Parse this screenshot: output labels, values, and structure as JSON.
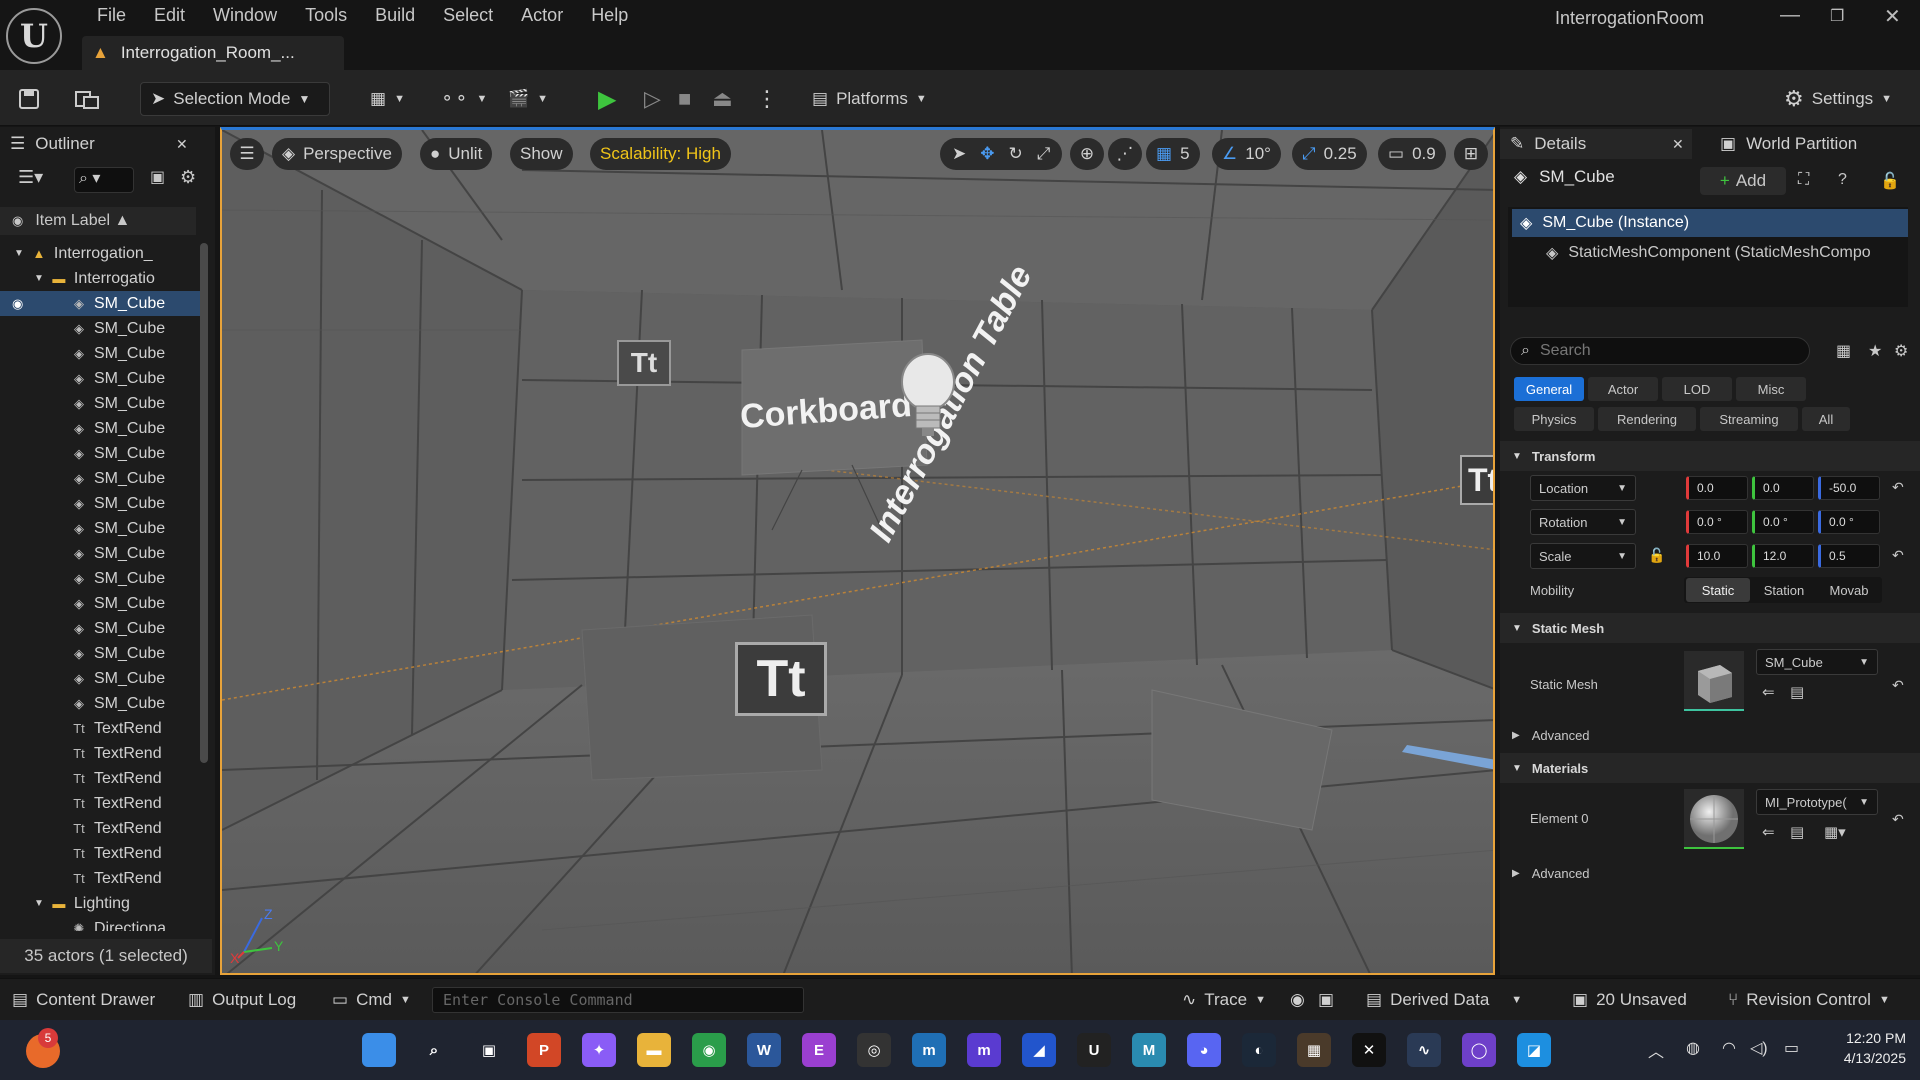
{
  "menubar": {
    "items": [
      "File",
      "Edit",
      "Window",
      "Tools",
      "Build",
      "Select",
      "Actor",
      "Help"
    ]
  },
  "document_tab": "Interrogation_Room_...",
  "window_title": "InterrogationRoom",
  "toolbar": {
    "selection_mode": "Selection Mode",
    "platforms": "Platforms",
    "settings": "Settings"
  },
  "outliner": {
    "tab": "Outliner",
    "column": "Item Label ▲",
    "tree": [
      {
        "label": "Interrogation_",
        "icon": "level-icon",
        "indent": 1
      },
      {
        "label": "Interrogatio",
        "icon": "folder-icon",
        "indent": 2
      },
      {
        "label": "SM_Cube",
        "icon": "mesh-icon",
        "indent": 3,
        "selected": true
      },
      {
        "label": "SM_Cube",
        "icon": "mesh-icon",
        "indent": 3
      },
      {
        "label": "SM_Cube",
        "icon": "mesh-icon",
        "indent": 3
      },
      {
        "label": "SM_Cube",
        "icon": "mesh-icon",
        "indent": 3
      },
      {
        "label": "SM_Cube",
        "icon": "mesh-icon",
        "indent": 3
      },
      {
        "label": "SM_Cube",
        "icon": "mesh-icon",
        "indent": 3
      },
      {
        "label": "SM_Cube",
        "icon": "mesh-icon",
        "indent": 3
      },
      {
        "label": "SM_Cube",
        "icon": "mesh-icon",
        "indent": 3
      },
      {
        "label": "SM_Cube",
        "icon": "mesh-icon",
        "indent": 3
      },
      {
        "label": "SM_Cube",
        "icon": "mesh-icon",
        "indent": 3
      },
      {
        "label": "SM_Cube",
        "icon": "mesh-icon",
        "indent": 3
      },
      {
        "label": "SM_Cube",
        "icon": "mesh-icon",
        "indent": 3
      },
      {
        "label": "SM_Cube",
        "icon": "mesh-icon",
        "indent": 3
      },
      {
        "label": "SM_Cube",
        "icon": "mesh-icon",
        "indent": 3
      },
      {
        "label": "SM_Cube",
        "icon": "mesh-icon",
        "indent": 3
      },
      {
        "label": "SM_Cube",
        "icon": "mesh-icon",
        "indent": 3
      },
      {
        "label": "SM_Cube",
        "icon": "mesh-icon",
        "indent": 3
      },
      {
        "label": "TextRend",
        "icon": "text-render-icon",
        "indent": 3
      },
      {
        "label": "TextRend",
        "icon": "text-render-icon",
        "indent": 3
      },
      {
        "label": "TextRend",
        "icon": "text-render-icon",
        "indent": 3
      },
      {
        "label": "TextRend",
        "icon": "text-render-icon",
        "indent": 3
      },
      {
        "label": "TextRend",
        "icon": "text-render-icon",
        "indent": 3
      },
      {
        "label": "TextRend",
        "icon": "text-render-icon",
        "indent": 3
      },
      {
        "label": "TextRend",
        "icon": "text-render-icon",
        "indent": 3
      },
      {
        "label": "Lighting",
        "icon": "folder-icon",
        "indent": 2
      },
      {
        "label": "Directiona",
        "icon": "light-icon",
        "indent": 3
      }
    ],
    "footer": "35 actors (1 selected)"
  },
  "viewport": {
    "perspective": "Perspective",
    "unlit": "Unlit",
    "show": "Show",
    "scalability": "Scalability: High",
    "grid_snap": "5",
    "angle_snap": "10°",
    "scale_snap": "0.25",
    "camera_speed": "0.9",
    "corkboard_text": "Corkboard",
    "interrogation_text": "Interrogation Table",
    "axis": {
      "z": "Z",
      "y": "Y",
      "x": "X"
    }
  },
  "details": {
    "tab": "Details",
    "tab2": "World Partition",
    "actor_name": "SM_Cube",
    "add": "Add",
    "components": [
      "SM_Cube (Instance)",
      "StaticMeshComponent (StaticMeshCompo"
    ],
    "search_placeholder": "Search",
    "filters_row1": [
      "General",
      "Actor",
      "LOD",
      "Misc"
    ],
    "filters_row2": [
      "Physics",
      "Rendering",
      "Streaming",
      "All"
    ],
    "transform": {
      "title": "Transform",
      "location": {
        "label": "Location",
        "x": "0.0",
        "y": "0.0",
        "z": "-50.0"
      },
      "rotation": {
        "label": "Rotation",
        "x": "0.0 °",
        "y": "0.0 °",
        "z": "0.0 °"
      },
      "scale": {
        "label": "Scale",
        "x": "10.0",
        "y": "12.0",
        "z": "0.5"
      },
      "mobility": {
        "label": "Mobility",
        "options": [
          "Static",
          "Station",
          "Movab"
        ]
      }
    },
    "static_mesh": {
      "title": "Static Mesh",
      "label": "Static Mesh",
      "value": "SM_Cube"
    },
    "advanced": "Advanced",
    "materials": {
      "title": "Materials",
      "label": "Element 0",
      "value": "MI_Prototype("
    }
  },
  "statusbar": {
    "content_drawer": "Content Drawer",
    "output_log": "Output Log",
    "cmd": "Cmd",
    "console_placeholder": "Enter Console Command",
    "trace": "Trace",
    "derived_data": "Derived Data",
    "unsaved": "20 Unsaved",
    "revision_control": "Revision Control"
  },
  "taskbar": {
    "badge": "5",
    "time": "12:20 PM",
    "date": "4/13/2025",
    "apps": [
      {
        "name": "windows-start-icon",
        "color": "#3b8ee8",
        "label": ""
      },
      {
        "name": "search-icon",
        "color": "#1f2430",
        "label": "⌕"
      },
      {
        "name": "task-view-icon",
        "color": "#1f2430",
        "label": "▣"
      },
      {
        "name": "powerpoint-icon",
        "color": "#d24726",
        "label": "P"
      },
      {
        "name": "copilot-icon",
        "color": "#8a5cf6",
        "label": "✦"
      },
      {
        "name": "file-explorer-icon",
        "color": "#e8b33a",
        "label": "▬"
      },
      {
        "name": "chrome-icon",
        "color": "#2a9d4a",
        "label": "◉"
      },
      {
        "name": "word-icon",
        "color": "#2b579a",
        "label": "W"
      },
      {
        "name": "editor-icon",
        "color": "#9a3fd0",
        "label": "E"
      },
      {
        "name": "obs-icon",
        "color": "#333",
        "label": "◎"
      },
      {
        "name": "vscode-insiders-icon",
        "color": "#1f6fb5",
        "label": "m"
      },
      {
        "name": "mu-icon",
        "color": "#5a3bd0",
        "label": "m"
      },
      {
        "name": "app-icon",
        "color": "#2255cc",
        "label": "◢"
      },
      {
        "name": "unreal-icon",
        "color": "#222",
        "label": "U"
      },
      {
        "name": "maya-icon",
        "color": "#2a8bb0",
        "label": "M"
      },
      {
        "name": "discord-icon",
        "color": "#5865f2",
        "label": "◕"
      },
      {
        "name": "steam-icon",
        "color": "#1b2838",
        "label": "◐"
      },
      {
        "name": "minecraft-icon",
        "color": "#4a3a2a",
        "label": "▦"
      },
      {
        "name": "capcut-icon",
        "color": "#111",
        "label": "✕"
      },
      {
        "name": "monitor-icon",
        "color": "#2a3a55",
        "label": "∿"
      },
      {
        "name": "github-icon",
        "color": "#6e40c9",
        "label": "◯"
      },
      {
        "name": "paint-icon",
        "color": "#1d8fe0",
        "label": "◪"
      }
    ]
  }
}
